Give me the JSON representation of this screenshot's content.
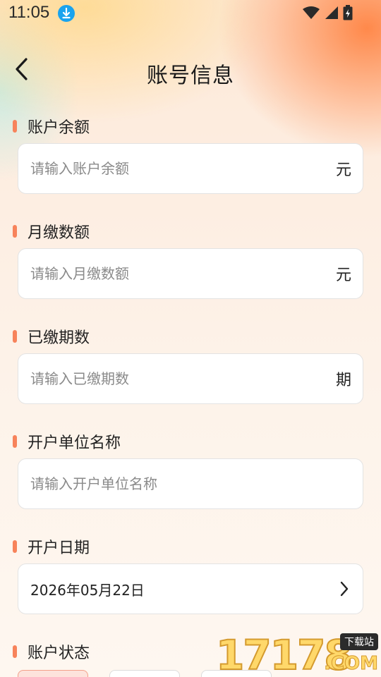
{
  "status_bar": {
    "time": "11:05",
    "icons": [
      "download-icon",
      "wifi-icon",
      "signal-icon",
      "battery-icon"
    ]
  },
  "header": {
    "title": "账号信息",
    "back_icon": "chevron-left-icon"
  },
  "form": {
    "balance": {
      "label": "账户余额",
      "placeholder": "请输入账户余额",
      "unit": "元"
    },
    "monthly": {
      "label": "月缴数额",
      "placeholder": "请输入月缴数额",
      "unit": "元"
    },
    "periods": {
      "label": "已缴期数",
      "placeholder": "请输入已缴期数",
      "unit": "期"
    },
    "company": {
      "label": "开户单位名称",
      "placeholder": "请输入开户单位名称"
    },
    "open_date": {
      "label": "开户日期",
      "value": "2026年05月22日"
    },
    "account_status": {
      "label": "账户状态"
    }
  },
  "watermark": {
    "number": "17178",
    "tag": "下载站",
    "suffix": ".COM"
  },
  "colors": {
    "accent": "#f7835b",
    "download_badge": "#1aa3ee"
  }
}
